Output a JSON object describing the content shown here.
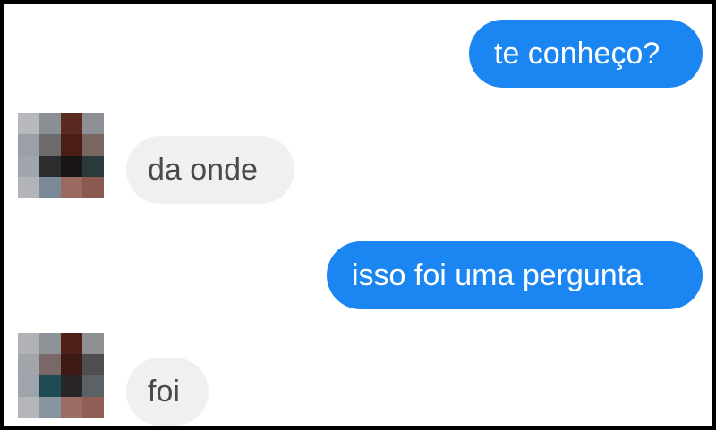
{
  "conversation": {
    "messages": [
      {
        "sender": "me",
        "text": "te conheço?"
      },
      {
        "sender": "contact",
        "text": "da onde"
      },
      {
        "sender": "me",
        "text": "isso foi uma pergunta"
      },
      {
        "sender": "contact",
        "text": "foi"
      }
    ]
  },
  "colors": {
    "sent_bubble": "#1b86f2",
    "sent_text": "#ffffff",
    "received_bubble": "#f0f0f0",
    "received_text": "#4a4a4a"
  },
  "icons": {
    "contact_avatar": "pixelated-avatar-icon"
  }
}
